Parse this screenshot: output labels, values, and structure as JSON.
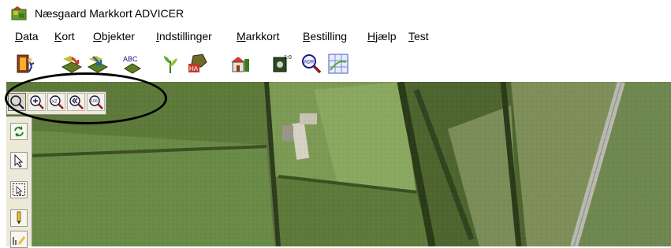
{
  "window": {
    "title": "Næsgaard Markkort ADVICER"
  },
  "menubar": {
    "items": [
      {
        "label": "Data",
        "accel": "D",
        "rest": "ata"
      },
      {
        "label": "Kort",
        "accel": "K",
        "rest": "ort"
      },
      {
        "label": "Objekter",
        "accel": "O",
        "rest": "bjekter"
      },
      {
        "label": "Indstillinger",
        "accel": "I",
        "rest": "ndstillinger"
      },
      {
        "label": "Markkort",
        "accel": "M",
        "rest": "arkkort"
      },
      {
        "label": "Bestilling",
        "accel": "B",
        "rest": "estilling"
      },
      {
        "label": "Hjælp",
        "accel": "H",
        "rest": "jælp"
      },
      {
        "label": "Test",
        "accel": "T",
        "rest": "est"
      }
    ]
  },
  "toolbar": {
    "abc_label": "ABC",
    "ha_label": "HA",
    "adr_label": "ADR",
    "scale_label": "1:0",
    "buttons": [
      "exit-door-icon",
      "import-icon",
      "export-icon",
      "abc-label-icon",
      "plant-icon",
      "ha-area-icon",
      "farm-house-icon",
      "scale-map-icon",
      "address-search-icon",
      "grid-icon"
    ]
  },
  "zoombar": {
    "x2_label": "x2",
    "full_label": "100",
    "buttons": [
      "zoom-icon",
      "zoom-in-icon",
      "zoom-x2-icon",
      "zoom-previous-icon",
      "zoom-full-icon"
    ]
  },
  "vtools": {
    "buttons": [
      "refresh-icon",
      "select-arrow-icon",
      "select-area-icon",
      "pencil-icon",
      "measure-icon"
    ]
  },
  "colors": {
    "highlight": "#000000",
    "toolbar_bg": "#ece9d8"
  }
}
